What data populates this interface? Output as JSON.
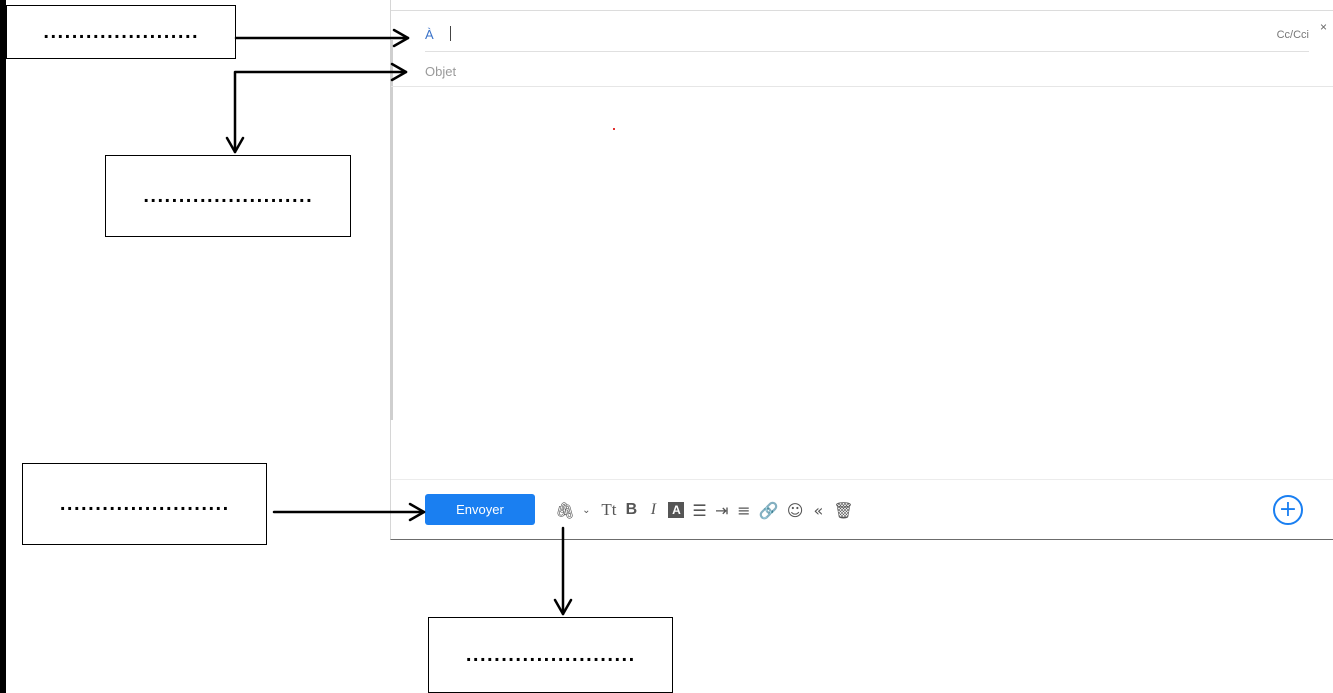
{
  "compose": {
    "to_label": "À",
    "cc_label": "Cc/Cci",
    "close_glyph": "×",
    "subject_placeholder": "Objet",
    "send_label": "Envoyer",
    "plus_glyph": "+"
  },
  "toolbar": {
    "icons": [
      {
        "name": "attach-icon",
        "glyph": "🖇"
      },
      {
        "name": "chevron-down-icon",
        "glyph": "⌄"
      },
      {
        "name": "text-size-icon",
        "glyph": "Tt"
      },
      {
        "name": "bold-icon",
        "glyph": "B"
      },
      {
        "name": "italic-icon",
        "glyph": "I"
      },
      {
        "name": "text-background-icon",
        "glyph": "A"
      },
      {
        "name": "bullet-list-icon",
        "glyph": "☰"
      },
      {
        "name": "indent-icon",
        "glyph": "⇥"
      },
      {
        "name": "align-icon",
        "glyph": "≡"
      },
      {
        "name": "link-icon",
        "glyph": "🔗"
      },
      {
        "name": "emoji-icon",
        "glyph": "☺"
      },
      {
        "name": "quote-icon",
        "glyph": "«"
      },
      {
        "name": "trash-icon",
        "glyph": "🗑"
      }
    ]
  },
  "labels": {
    "box_to": "......................",
    "box_subject": "........................",
    "box_send": "........................",
    "box_toolbar": "........................"
  },
  "colors": {
    "accent": "#1a7ff1",
    "to_label": "#3b73c9",
    "placeholder": "#9a9a9a"
  }
}
